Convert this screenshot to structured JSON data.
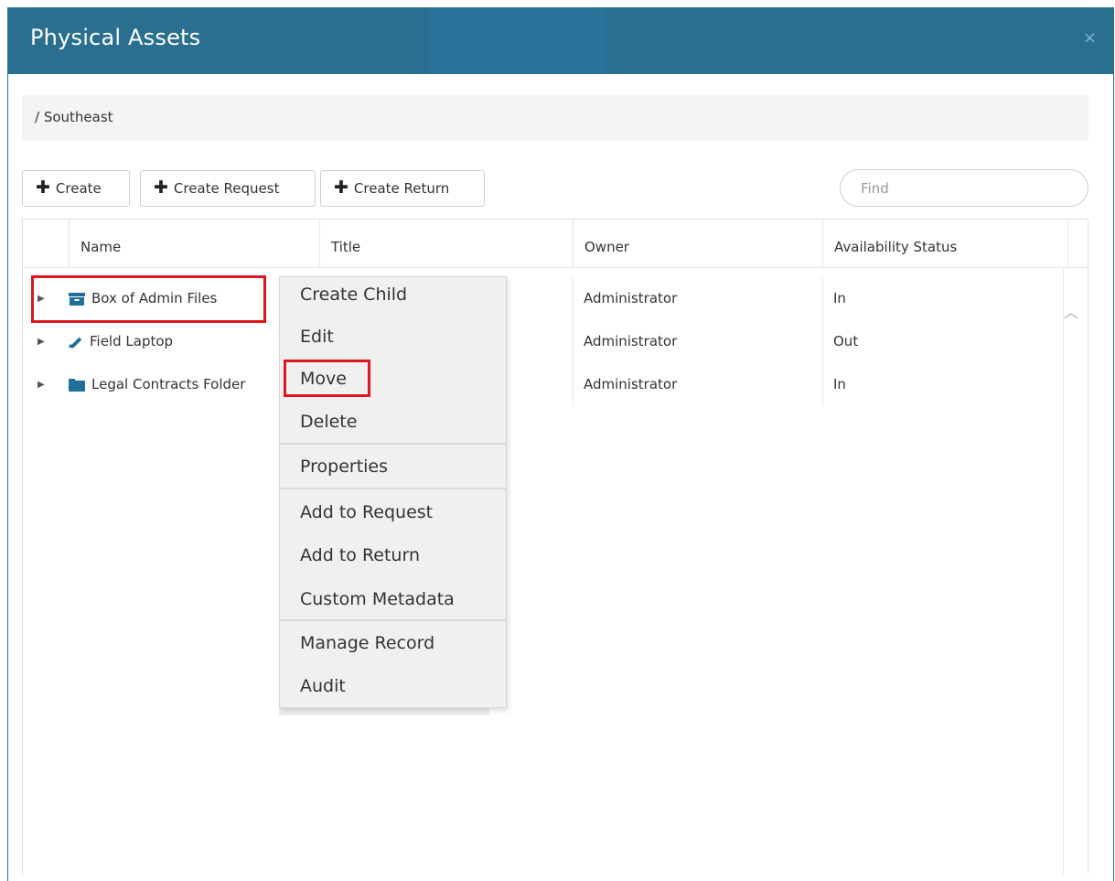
{
  "dialog": {
    "title": "Physical Assets",
    "close_label": "×"
  },
  "breadcrumb": {
    "path": "/ Southeast"
  },
  "toolbar": {
    "create_label": "Create",
    "create_request_label": "Create Request",
    "create_return_label": "Create Return",
    "find_placeholder": "Find"
  },
  "grid": {
    "columns": [
      "Name",
      "Title",
      "Owner",
      "Availability Status"
    ],
    "rows": [
      {
        "name": "Box of Admin Files",
        "icon": "box-icon",
        "owner": "Administrator",
        "status": "In"
      },
      {
        "name": "Field Laptop",
        "icon": "pencil-icon",
        "owner": "Administrator",
        "status": "Out"
      },
      {
        "name": "Legal Contracts Folder",
        "icon": "folder-icon",
        "owner": "Administrator",
        "status": "In"
      }
    ]
  },
  "context_menu": {
    "items": [
      "Create Child",
      "Edit",
      "Move",
      "Delete",
      "Properties",
      "Add to Request",
      "Add to Return",
      "Custom Metadata",
      "Manage Record",
      "Audit"
    ]
  },
  "colors": {
    "header": "#2a6f8f",
    "icon": "#1f6f96",
    "highlight": "#e0141e"
  }
}
